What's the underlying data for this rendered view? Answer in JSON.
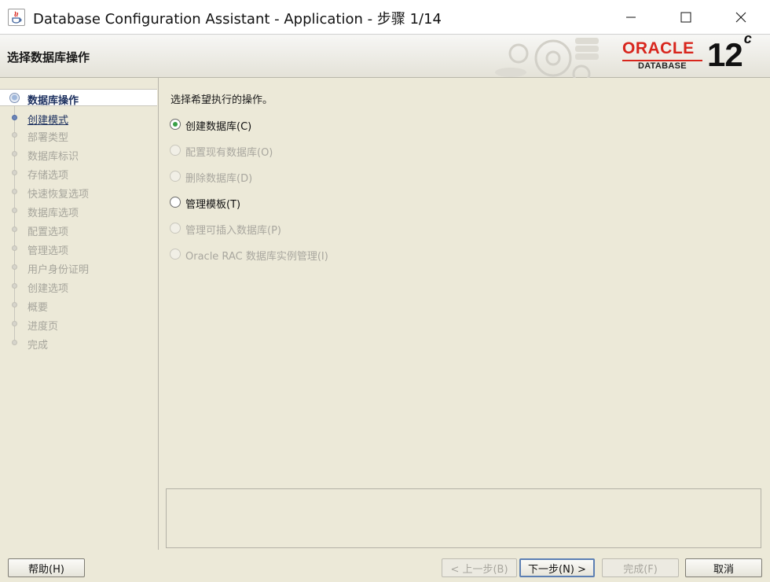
{
  "window": {
    "title": "Database Configuration Assistant - Application - 步骤 1/14"
  },
  "header": {
    "page_title": "选择数据库操作",
    "logo_brand": "ORACLE",
    "logo_product": "DATABASE",
    "logo_version": "12",
    "logo_version_suffix": "c"
  },
  "nav": {
    "steps": [
      {
        "label": "数据库操作",
        "state": "current"
      },
      {
        "label": "创建模式",
        "state": "link"
      },
      {
        "label": "部署类型",
        "state": "disabled"
      },
      {
        "label": "数据库标识",
        "state": "disabled"
      },
      {
        "label": "存储选项",
        "state": "disabled"
      },
      {
        "label": "快速恢复选项",
        "state": "disabled"
      },
      {
        "label": "数据库选项",
        "state": "disabled"
      },
      {
        "label": "配置选项",
        "state": "disabled"
      },
      {
        "label": "管理选项",
        "state": "disabled"
      },
      {
        "label": "用户身份证明",
        "state": "disabled"
      },
      {
        "label": "创建选项",
        "state": "disabled"
      },
      {
        "label": "概要",
        "state": "disabled"
      },
      {
        "label": "进度页",
        "state": "disabled"
      },
      {
        "label": "完成",
        "state": "disabled"
      }
    ]
  },
  "main": {
    "prompt": "选择希望执行的操作。",
    "options": [
      {
        "label": "创建数据库(C)",
        "selected": true,
        "enabled": true
      },
      {
        "label": "配置现有数据库(O)",
        "selected": false,
        "enabled": false
      },
      {
        "label": "删除数据库(D)",
        "selected": false,
        "enabled": false
      },
      {
        "label": "管理模板(T)",
        "selected": false,
        "enabled": true
      },
      {
        "label": "管理可插入数据库(P)",
        "selected": false,
        "enabled": false
      },
      {
        "label": "Oracle RAC 数据库实例管理(I)",
        "selected": false,
        "enabled": false
      }
    ]
  },
  "footer": {
    "help": "帮助(H)",
    "back": "< 上一步(B)",
    "next": "下一步(N) >",
    "finish": "完成(F)",
    "cancel": "取消"
  },
  "colors": {
    "background": "#ece9d8",
    "oracle_red": "#d8261d",
    "nav_link": "#1b2f5e",
    "radio_selected": "#39a047"
  }
}
